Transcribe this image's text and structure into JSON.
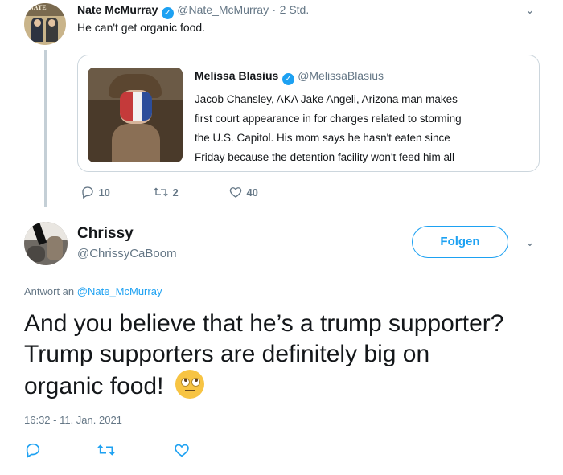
{
  "reply_context_tweet": {
    "author_name": "Nate McMurray",
    "author_handle": "@Nate_McMurray",
    "time_ago": "2 Std.",
    "text": "He can't get organic food.",
    "avatar_text": "NATE",
    "quoted": {
      "author_name": "Melissa Blasius",
      "author_handle": "@MelissaBlasius",
      "lines": [
        "Jacob Chansley, AKA Jake Angeli, Arizona man makes",
        "first court appearance in for charges related to storming",
        "the U.S. Capitol. His mom says he hasn't eaten since",
        "Friday because the detention facility won't feed him all"
      ]
    },
    "actions": {
      "replies": "10",
      "retweets": "2",
      "likes": "40"
    }
  },
  "main_tweet": {
    "author_name": "Chrissy",
    "author_handle": "@ChrissyCaBoom",
    "follow_label": "Folgen",
    "reply_prefix": "Antwort an",
    "reply_to": "@Nate_McMurray",
    "text_lines": [
      "And you believe that he’s a trump supporter?",
      "Trump supporters are definitely big on",
      "organic food!"
    ],
    "timestamp": "16:32 - 11. Jan. 2021"
  },
  "colors": {
    "accent": "#1da1f2",
    "secondary_text": "#657786",
    "border": "#ccd6dd"
  }
}
